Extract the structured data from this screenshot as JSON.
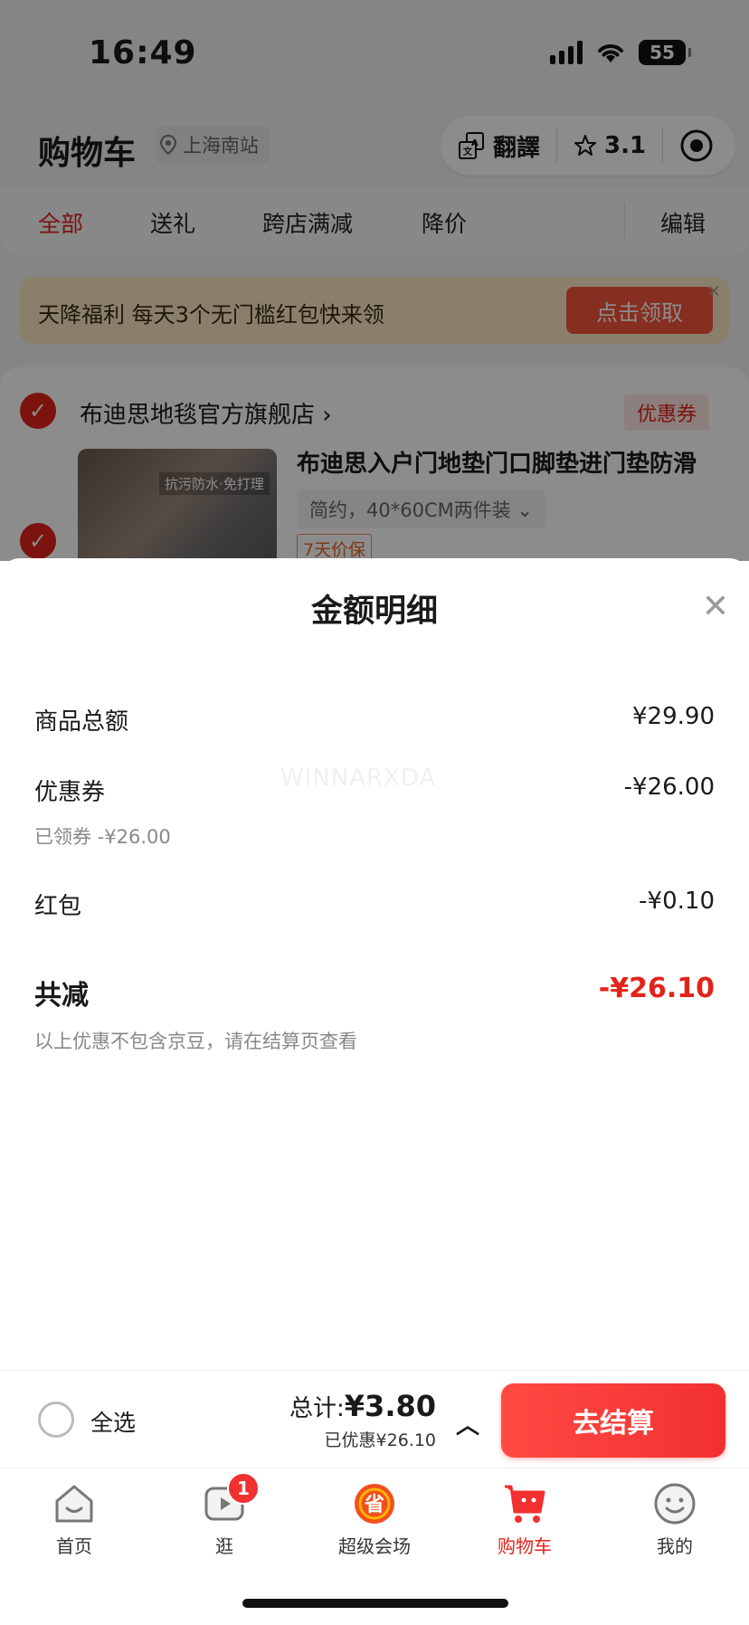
{
  "status_bar": {
    "time": "16:49",
    "battery": "55"
  },
  "header": {
    "title": "购物车",
    "location": "上海南站",
    "capsule": {
      "translate_label": "翻譯",
      "rating": "3.1"
    }
  },
  "tabs": {
    "all": "全部",
    "gift": "送礼",
    "cross_store": "跨店满减",
    "price_drop": "降价",
    "edit": "编辑"
  },
  "banner": {
    "text": "天降福利 每天3个无门槛红包快来领",
    "button": "点击领取"
  },
  "store": {
    "name": "布迪思地毯官方旗舰店",
    "coupon_tag": "优惠券",
    "product": {
      "image_text": "抗污防水·免打理",
      "title": "布迪思入户门地垫门口脚垫进门垫防滑",
      "spec": "简约，40*60CM两件装",
      "tag": "7天价保"
    }
  },
  "sheet": {
    "title": "金额明细",
    "watermark": "WINNARXDA",
    "rows": [
      {
        "label": "商品总额",
        "value": "¥29.90"
      },
      {
        "label": "优惠券",
        "value": "-¥26.00",
        "sub": "已领券 -¥26.00"
      },
      {
        "label": "红包",
        "value": "-¥0.10"
      }
    ],
    "total_label": "共减",
    "total_value": "-¥26.10",
    "note": "以上优惠不包含京豆，请在结算页查看"
  },
  "checkout": {
    "select_all": "全选",
    "total_prefix": "总计:",
    "total_amount": "¥3.80",
    "discount": "已优惠¥26.10",
    "pay_button": "去结算"
  },
  "tabbar": {
    "items": [
      {
        "label": "首页"
      },
      {
        "label": "逛",
        "badge": "1"
      },
      {
        "label": "超级会场"
      },
      {
        "label": "购物车"
      },
      {
        "label": "我的"
      }
    ]
  },
  "colors": {
    "accent": "#e2231a",
    "banner_bg": "#fbe7c4",
    "pay_button": "#f23030"
  }
}
